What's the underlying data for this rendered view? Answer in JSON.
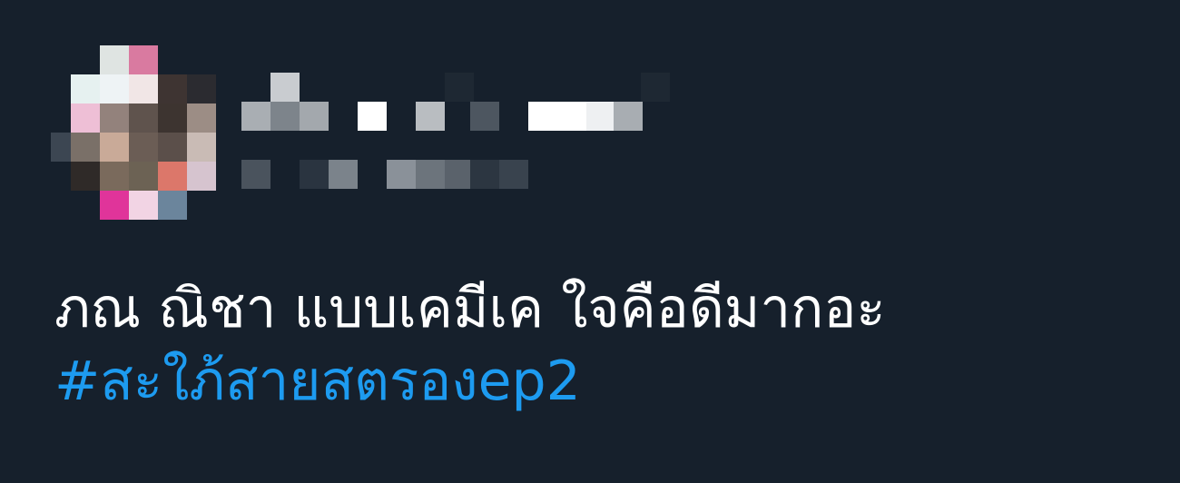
{
  "tweet": {
    "text": "ภณ ณิชา แบบเคมีเค ใจคือดีมากอะ",
    "hashtag": "#สะใภ้สายสตรองep2"
  },
  "colors": {
    "background": "#16202c",
    "text": "#ffffff",
    "link": "#1d9bf0"
  },
  "icons": {
    "avatar": "avatar-icon"
  }
}
